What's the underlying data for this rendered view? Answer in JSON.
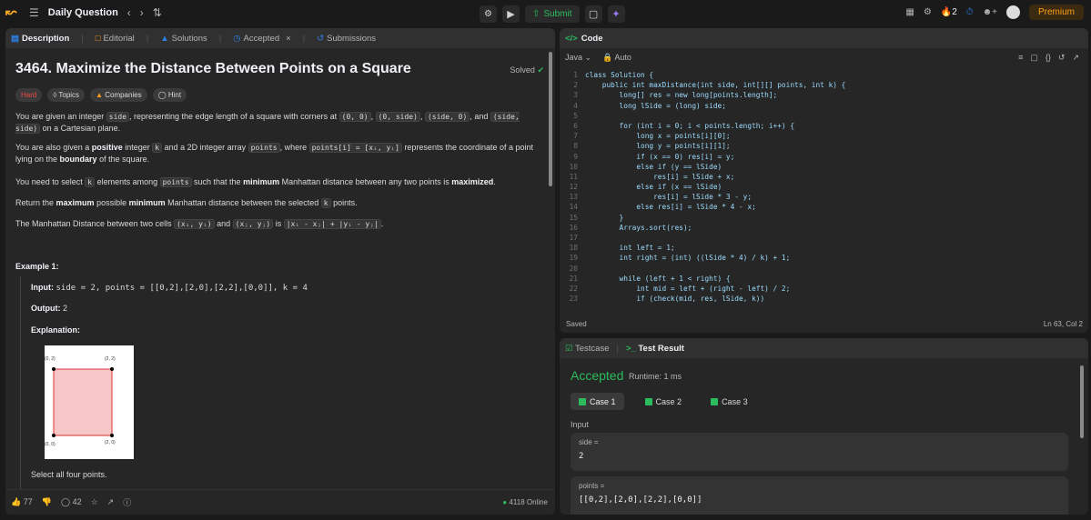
{
  "topbar": {
    "title": "Daily Question",
    "submit_label": "Submit",
    "streak": "2",
    "premium": "Premium"
  },
  "left_tabs": [
    "Description",
    "Editorial",
    "Solutions",
    "Accepted",
    "Submissions"
  ],
  "problem": {
    "title": "3464. Maximize the Distance Between Points on a Square",
    "solved": "Solved",
    "tags": [
      "Hard",
      "Topics",
      "Companies",
      "Hint"
    ],
    "p1a": "You are given an integer ",
    "p1_side": "side",
    "p1b": ", representing the edge length of a square with corners at ",
    "p1_c1": "(0, 0)",
    "p1_c2": "(0, side)",
    "p1_c3": "(side, 0)",
    "p1_and": ", and ",
    "p1_c4": "(side, side)",
    "p1c": " on a Cartesian plane.",
    "p2a": "You are also given a ",
    "p2_pos": "positive",
    "p2b": " integer ",
    "p2_k": "k",
    "p2c": " and a 2D integer array ",
    "p2_points": "points",
    "p2d": ", where ",
    "p2_pi": "points[i] = [xᵢ, yᵢ]",
    "p2e": " represents the coordinate of a point lying on the ",
    "p2_boundary": "boundary",
    "p2f": " of the square.",
    "p3a": "You need to select ",
    "p3_k": "k",
    "p3b": " elements among ",
    "p3_points": "points",
    "p3c": " such that the ",
    "p3_min": "minimum",
    "p3d": " Manhattan distance between any two points is ",
    "p3_max": "maximized",
    "p3e": ".",
    "p4a": "Return the ",
    "p4_max": "maximum",
    "p4b": " possible ",
    "p4_min": "minimum",
    "p4c": " Manhattan distance between the selected ",
    "p4_k": "k",
    "p4d": " points.",
    "p5a": "The Manhattan Distance between two cells ",
    "p5_c1": "(xᵢ, yᵢ)",
    "p5_and": " and ",
    "p5_c2": "(xⱼ, yⱼ)",
    "p5_is": " is ",
    "p5_f": "|xᵢ - xⱼ| + |yᵢ - yⱼ|",
    "p5e": "."
  },
  "example": {
    "heading": "Example 1:",
    "input_label": "Input:",
    "input_value": "side = 2, points = [[0,2],[2,0],[2,2],[0,0]], k = 4",
    "output_label": "Output:",
    "output_value": "2",
    "explanation_label": "Explanation:",
    "fig_labels": [
      "(0, 2)",
      "(2, 2)",
      "(0, 0)",
      "(2, 0)"
    ],
    "note": "Select all four points."
  },
  "left_bottom": {
    "likes": "77",
    "comments": "42",
    "online": "4118 Online"
  },
  "code_panel": {
    "title": "Code",
    "language": "Java",
    "auto": "Auto",
    "saved": "Saved",
    "cursor": "Ln 63, Col 2",
    "lines": [
      "class Solution {",
      "    public int maxDistance(int side, int[][] points, int k) {",
      "        long[] res = new long[points.length];",
      "        long lSide = (long) side;",
      "",
      "        for (int i = 0; i < points.length; i++) {",
      "            long x = points[i][0];",
      "            long y = points[i][1];",
      "            if (x == 0) res[i] = y;",
      "            else if (y == lSide)",
      "                res[i] = lSide + x;",
      "            else if (x == lSide)",
      "                res[i] = lSide * 3 - y;",
      "            else res[i] = lSide * 4 - x;",
      "        }",
      "        Arrays.sort(res);",
      "",
      "        int left = 1;",
      "        int right = (int) ((lSide * 4) / k) + 1;",
      "",
      "        while (left + 1 < right) {",
      "            int mid = left + (right - left) / 2;",
      "            if (check(mid, res, lSide, k))"
    ]
  },
  "result_panel": {
    "tab1": "Testcase",
    "tab2": "Test Result",
    "status": "Accepted",
    "runtime": "Runtime: 1 ms",
    "cases": [
      "Case 1",
      "Case 2",
      "Case 3"
    ],
    "input_label": "Input",
    "side_name": "side =",
    "side_value": "2",
    "points_name": "points =",
    "points_value": "[[0,2],[2,0],[2,2],[0,0]]"
  },
  "colors": {
    "accent_green": "#2cbb5d",
    "hard_red": "#ef4743",
    "premium_orange": "#ffa116"
  }
}
